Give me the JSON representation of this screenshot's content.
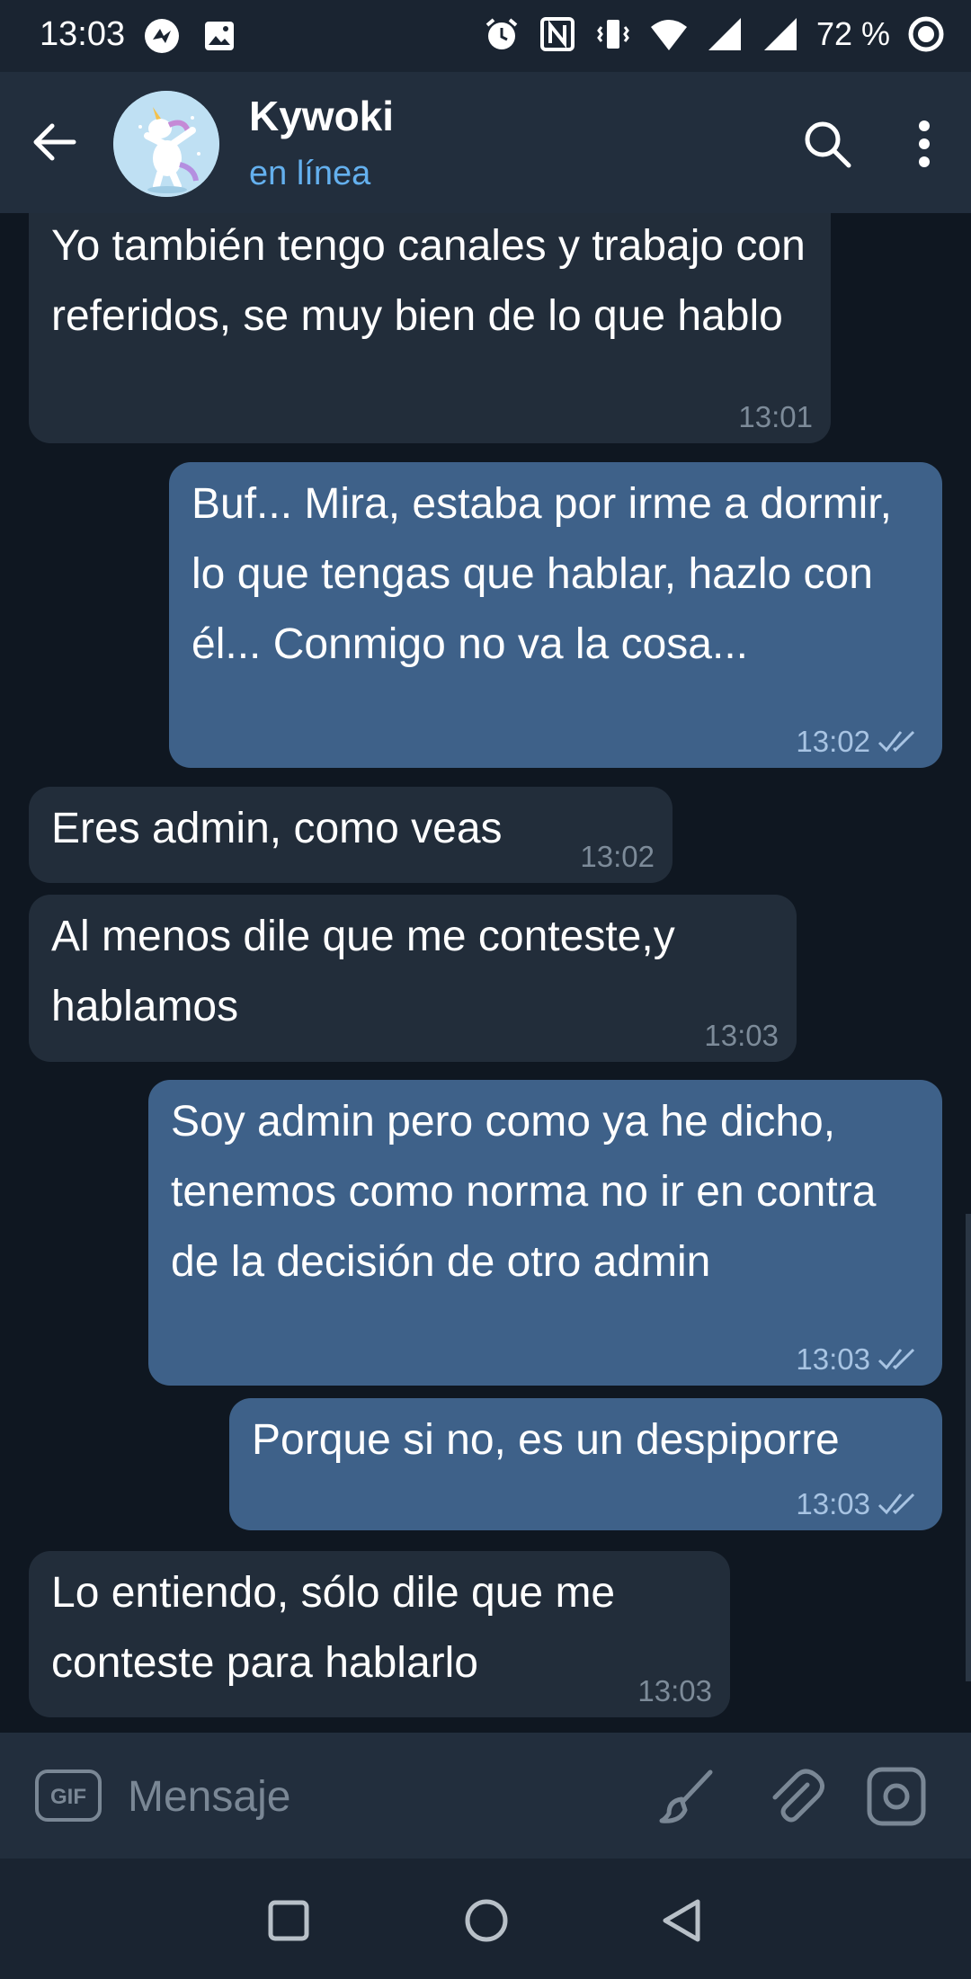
{
  "status_bar": {
    "time": "13:03",
    "battery": "72 %"
  },
  "header": {
    "title": "Kywoki",
    "status": "en línea"
  },
  "messages": [
    {
      "direction": "in",
      "text": "Yo también tengo canales y trabajo con referidos, se muy bien de lo que hablo",
      "time": "13:01"
    },
    {
      "direction": "out",
      "text": "Buf... Mira, estaba por irme a dormir, lo que tengas que hablar, hazlo con él... Conmigo no va la cosa...",
      "time": "13:02",
      "read": true
    },
    {
      "direction": "in",
      "text": "Eres admin, como veas",
      "time": "13:02"
    },
    {
      "direction": "in",
      "text": "Al menos dile que me conteste,y hablamos",
      "time": "13:03"
    },
    {
      "direction": "out",
      "text": "Soy admin pero como ya he dicho, tenemos como norma no ir en contra de la decisión de otro admin",
      "time": "13:03",
      "read": true
    },
    {
      "direction": "out",
      "text": "Porque si no, es un despiporre",
      "time": "13:03",
      "read": true
    },
    {
      "direction": "in",
      "text": "Lo entiendo, sólo dile que me conteste para hablarlo",
      "time": "13:03"
    }
  ],
  "input": {
    "placeholder": "Mensaje",
    "gif_label": "GIF"
  },
  "colors": {
    "background": "#0f1721",
    "header": "#222e3d",
    "incoming_bubble": "#222d3a",
    "outgoing_bubble": "#3e6189",
    "accent": "#64b0ee"
  }
}
